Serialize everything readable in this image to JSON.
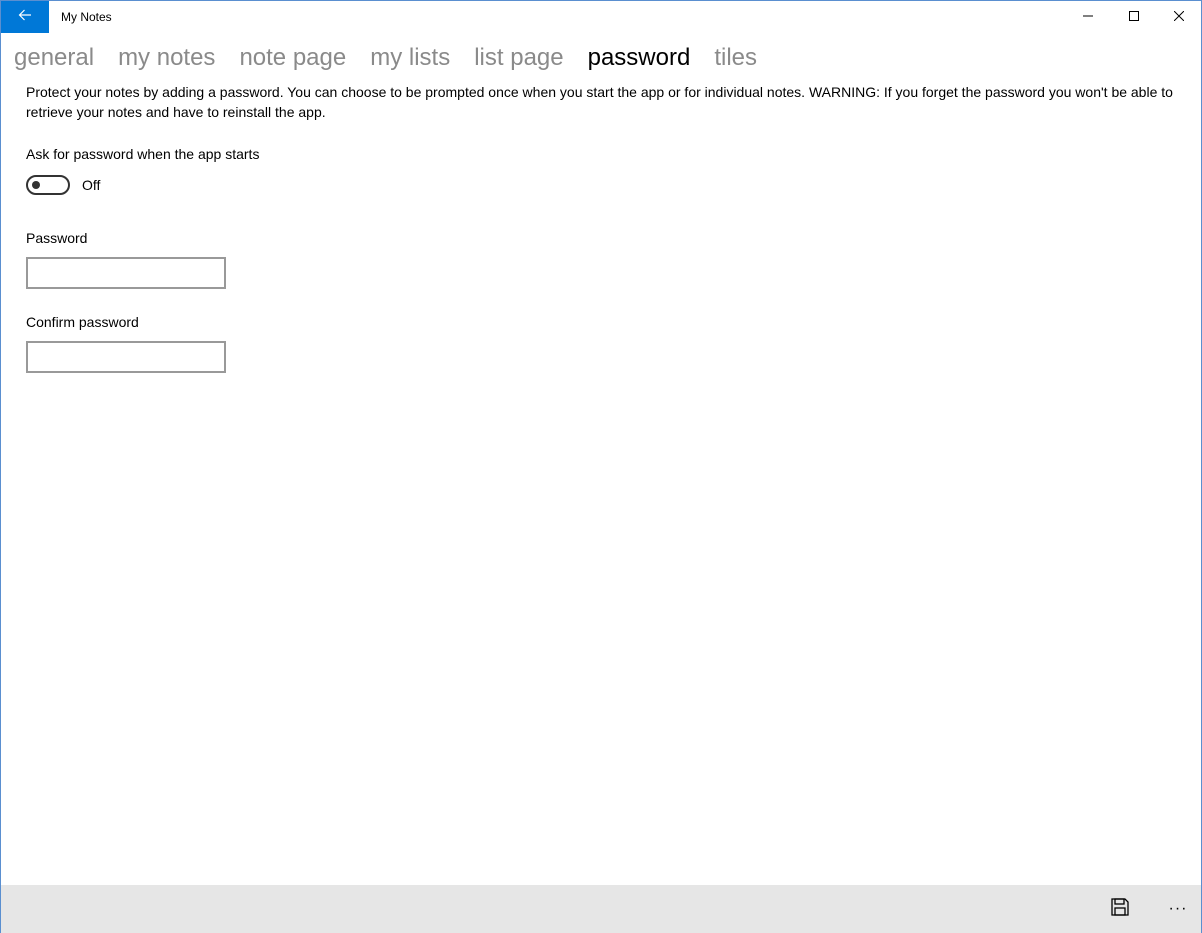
{
  "window": {
    "title": "My Notes",
    "accent_color": "#0078d7"
  },
  "icons": {
    "back": "back-arrow-icon",
    "minimize": "minimize-icon",
    "maximize": "maximize-icon",
    "close": "close-icon",
    "save": "save-icon",
    "more": "more-icon"
  },
  "pivot": {
    "tabs": [
      {
        "label": "general",
        "active": false
      },
      {
        "label": "my notes",
        "active": false
      },
      {
        "label": "note page",
        "active": false
      },
      {
        "label": "my lists",
        "active": false
      },
      {
        "label": "list page",
        "active": false
      },
      {
        "label": "password",
        "active": true
      },
      {
        "label": "tiles",
        "active": false
      }
    ]
  },
  "password_page": {
    "description": "Protect your notes by adding a password. You can choose to be prompted once when you start the app or for individual notes.  WARNING: If you forget the password you won't be able to retrieve your notes and have to reinstall the app.",
    "toggle_header": "Ask for password when the app starts",
    "toggle_state": "Off",
    "password_label": "Password",
    "password_value": "",
    "confirm_label": "Confirm password",
    "confirm_value": ""
  },
  "command_bar": {
    "more_label": "···"
  }
}
